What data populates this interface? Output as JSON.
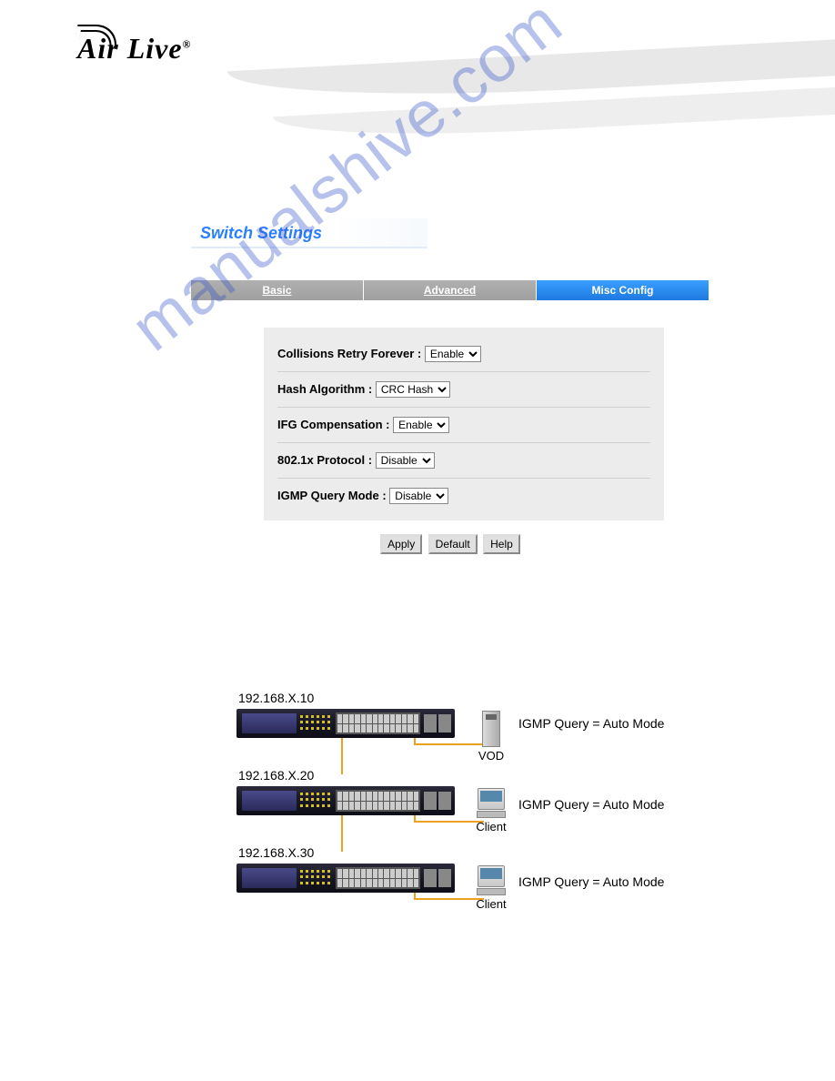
{
  "logo_text": "Air Live",
  "logo_reg": "®",
  "watermark": "manualshive.com",
  "panel": {
    "title": "Switch Settings",
    "tabs": {
      "basic": "Basic",
      "advanced": "Advanced",
      "misc": "Misc Config"
    },
    "rows": {
      "collisions_label": "Collisions Retry Forever :",
      "collisions_value": "Enable",
      "hash_label": "Hash Algorithm :",
      "hash_value": "CRC Hash",
      "ifg_label": "IFG Compensation :",
      "ifg_value": "Enable",
      "dot1x_label": "802.1x Protocol :",
      "dot1x_value": "Disable",
      "igmp_label": "IGMP Query Mode :",
      "igmp_value": "Disable"
    },
    "buttons": {
      "apply": "Apply",
      "default": "Default",
      "help": "Help"
    }
  },
  "diagram": {
    "ip1": "192.168.X.10",
    "ip2": "192.168.X.20",
    "ip3": "192.168.X.30",
    "dev1": "VOD",
    "dev2": "Client",
    "dev3": "Client",
    "ann1": "IGMP Query = Auto Mode",
    "ann2": "IGMP Query = Auto Mode",
    "ann3": "IGMP Query = Auto Mode"
  }
}
